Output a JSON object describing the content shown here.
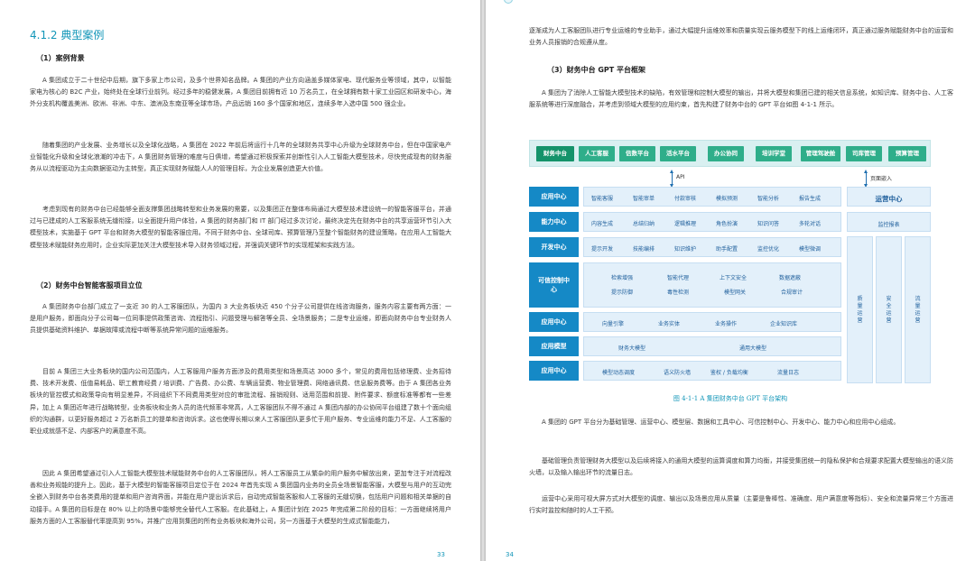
{
  "left": {
    "section_title": "4.1.2 典型案例",
    "sub1": "（1）案例背景",
    "p1": "A 集团成立于二十世纪中后期，旗下多家上市公司，及多个世界知名品牌。A 集团的产业方向涵盖多媒体家电、现代服务业等领域，其中，以智能家电为核心的 B2C 产业，始终处在全球行业前列。经过多年的稳健发展，A 集团目前拥有近 10 万名员工，在全球拥有数十家工业园区和研发中心，海外分支机构覆盖美洲、欧洲、非洲、中东、澳洲及东南亚等全球市场，产品远销 160 多个国家和地区，连续多年入选中国 500 强企业。",
    "p2": "随着集团的产业发展、业务增长以及全球化战略，A 集团在 2022 年前后将运行十几年的全球财务共享中心升级为全球财务中台，但在中国家电产业智能化升级和全球化浪潮的冲击下，A 集团财务管理的难度与日俱增，希望通过积极探索并创新性引入人工智能大模型技术，尽快完成现有的财务服务从以流程驱动为主向数据驱动为主转型，真正实现财务赋能人人的管理目标，为企业发展创造更大价值。",
    "p3": "考虑到现有的财务中台已经能够全面支撑集团战略转型和业务发展的需要，以及集团正在整体布局通过大模型技术建设统一的智能客服平台，并通过与已建成的人工客服系统无缝衔接，以全面提升用户体验，A 集团的财务部门和 IT 部门经过多次讨论，最终决定先在财务中台的共享运营环节引入大模型技术，实施基于 GPT 平台和财务大模型的智能客服应用。不同于财务中台、全球司库、预算管理乃至整个智能财务的建设策略，在应用人工智能大模型技术赋能财务应用时，企业实际更加关注大模型技术导入财务领域过程，并强调关键环节的实现框架和实践方法。",
    "sub2": "（2）财务中台智能客服项目立位",
    "p4": "A 集团财务中台部门成立了一支近 30 的人工客服团队，为国内 3 大业务板块近 450 个分子公司提供在线咨询服务，服务内容主要有两方面：一是用户服务，即面向分子公司每一位同事提供政策咨询、流程指引、问题受理与解答等全员、全场景服务；二是专业运维，即面向财务中台专业财务人员提供基础资料维护、单据故障或流程中断等系统异常问题的运维服务。",
    "p5": "目前 A 集团三大业务板块的国内公司范围内，人工客服用户服务方面涉及的费用类型和场景高达 3000 多个，常见的费用包括修理费、业务招待费、技术开发费、低值易耗品、职工教育经费 / 培训费、广告费、办公费、车辆运营费、物业管理费、网络通讯费、信息服务费等。由于 A 集团各业务板块的管控模式和政策导向有明显差异，不同组织下不同费用类型对应的审批流程、报销规则、适用范围和前提、附件要求、额度标准等都有一些差异，加上 A 集团近年进行战略转型，业务板块和业务人员的迭代频率非常高，人工客服团队不得不通过 A 集团内部的办公协同平台组建了数十个面向组织的沟通群，以更好服务超过 2 万名新员工的提单和咨询诉求。这也使得长期以来人工客服团队更多忙于用户服务、专业运维的能力不足、人工客服的职业成就感不足、内部客户的满意度不高。",
    "p6": "因此 A 集团希望通过引入人工智能大模型技术赋能财务中台的人工客服团队，将人工客服员工从繁杂的用户服务中解放出来，更加专注于对流程改善和业务规能的提升上。因此，基于大模型的智能客服项目定位于在 2024 年首先实现 A 集团国内业务的全员全场景智能客服，大模型与用户的互动完全嵌入到财务中台各类费用的提单和用户咨询界面，并能在用户提出诉求后，自动完成智能客服和人工客服的无缝切换，包括用户问题和相关单据的自动接手。A 集团的目标是在 80% 以上的场景中能够完全替代人工客服。在此基础上，A 集团计划在 2025 年完成第二阶段的目标：一方面继续将用户服务方面的人工客服替代率提高到 95%，并推广应用到集团的所有业务板块和海外公司，另一方面基于大模型的生成式智能能力，",
    "page_number": "33"
  },
  "right": {
    "p0": "逐渐成为人工客服团队进行专业运维的专业助手，通过大幅提升运维效率和质量实现云服务模型下的线上运维闭环，真正通过服务赋能财务中台的运营和业务人员报销的合规遵从度。",
    "sub3": "（3）财务中台 GPT 平台框架",
    "p1": "A 集团为了消除人工智能大模型技术的缺陷，有效管理和控制大模型的输出，并将大模型和集团已建的相关信息系统，如知识库、财务中台、人工客服系统等进行深度融合，并考虑到领域大模型的应用约束，首先构建了财务中台的 GPT 平台如图 4-1-1 所示。",
    "caption": "图 4-1-1 A 集团财务中台 GPT 平台架构",
    "p2": "A 集团的 GPT 平台分为基础管理、运营中心、模型层、数据和工具中心、可信控制中心、开发中心、能力中心和应用中心组成。",
    "p3": "基础管理负责管理财务大模型以及后续将接入的通用大模型的运算调度和算力均衡，并接受集团统一的隐私保护和合规要求配置大模型输出的语义防火墙，以及输入输出环节的流量日志。",
    "p4": "运营中心采用可视大屏方式对大模型的调度、输出以及场景应用从质量（主要是鲁棒性、准确度、用户满意度等指标）、安全和流量异常三个方面进行实时监控和随时的人工干预。",
    "page_number": "34"
  },
  "diagram": {
    "top_buttons": [
      "财务中台",
      "人工客服",
      "信数平台",
      "活水平台",
      "办公协同",
      "培训学堂",
      "管理驾驶舱",
      "司库管理",
      "预算管理"
    ],
    "api_label": "API",
    "embed_label": "页面嵌入",
    "rows": [
      {
        "label": "应用中心",
        "items": [
          "智能客服",
          "智能审单",
          "付款审核",
          "模拟预测",
          "智能分析",
          "报告生成"
        ]
      },
      {
        "label": "能力中心",
        "items": [
          "内容生成",
          "总结归纳",
          "逻辑推理",
          "角色扮演",
          "知识问答",
          "多轮对话"
        ]
      },
      {
        "label": "开发中心",
        "items": [
          "提示开发",
          "技能编排",
          "知识维护",
          "助手配置",
          "监控优化",
          "模型微调"
        ]
      },
      {
        "label": "可信控制中心",
        "items": [
          "检索增强",
          "智能代理",
          "上下文安全",
          "数据遮蔽",
          "提示防御",
          "毒性检测",
          "模型网关",
          "合规审计"
        ]
      },
      {
        "label": "应用中心",
        "items": [
          "向量引擎",
          "业务实体",
          "业务操作",
          "企业知识库"
        ]
      },
      {
        "label": "应用模型",
        "items": [
          "财务大模型",
          "通用大模型"
        ]
      },
      {
        "label": "应用中心",
        "items": [
          "模型动态调度",
          "语义防火墙",
          "鉴权 / 负载均衡",
          "流量日志"
        ]
      }
    ],
    "ops_center": "运营中心",
    "monitor_report": "监控报表",
    "vertical": [
      "质量运营",
      "安全运营",
      "流量运营"
    ]
  }
}
